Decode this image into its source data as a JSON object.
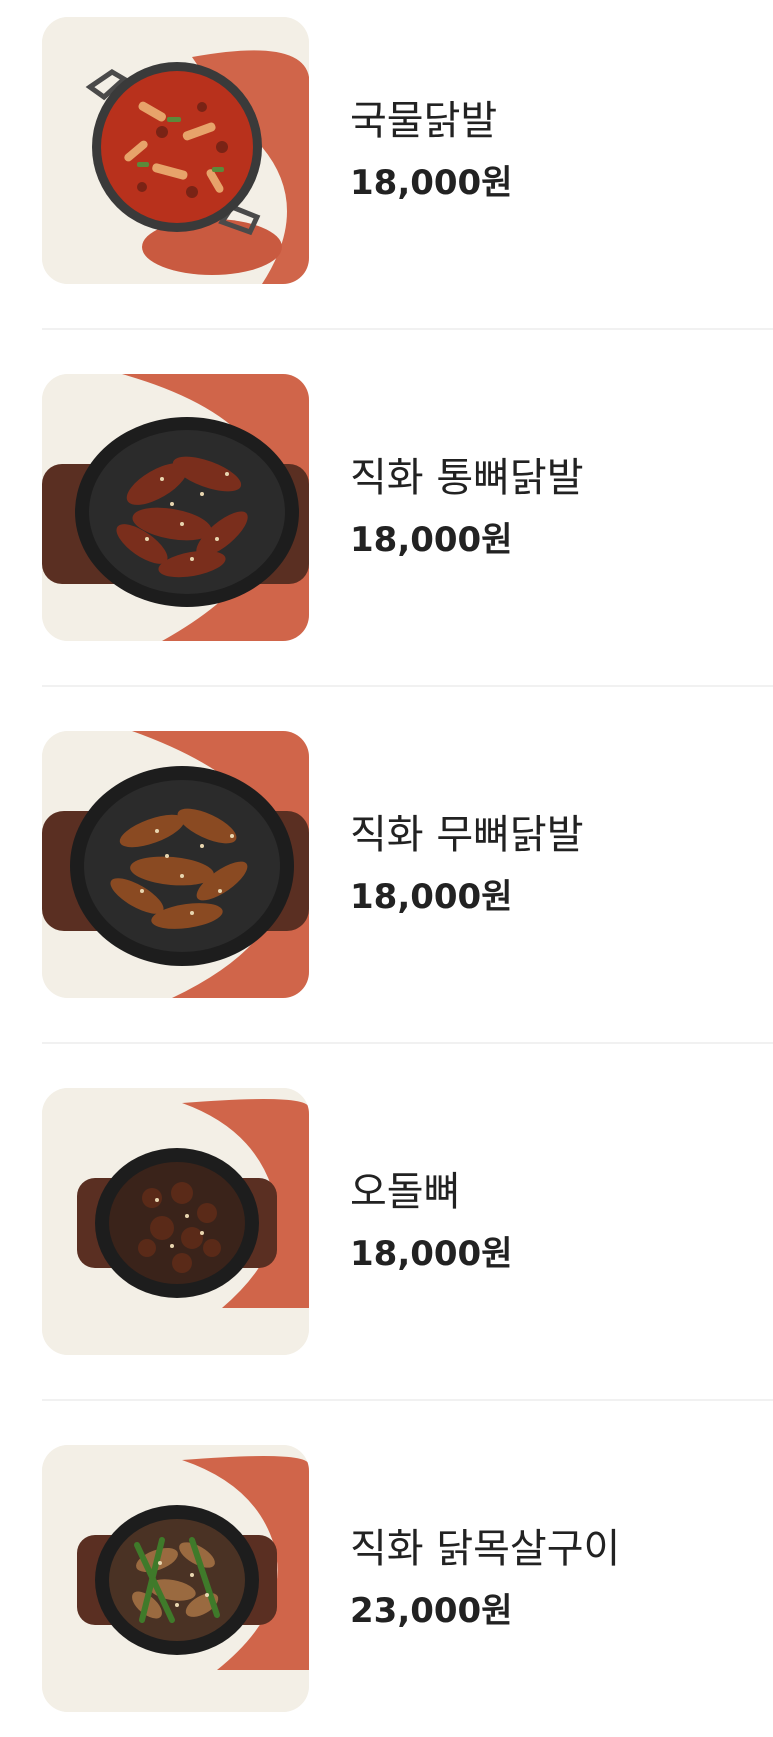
{
  "menu": {
    "items": [
      {
        "name": "국물닭발",
        "price": "18,000원",
        "image": "spicy-chicken-feet-soup-photo"
      },
      {
        "name": "직화 통뼈닭발",
        "price": "18,000원",
        "image": "grilled-bone-in-chicken-feet-photo"
      },
      {
        "name": "직화 무뼈닭발",
        "price": "18,000원",
        "image": "grilled-boneless-chicken-feet-photo"
      },
      {
        "name": "오돌뼈",
        "price": "18,000원",
        "image": "grilled-pork-cartilage-photo"
      },
      {
        "name": "직화 닭목살구이",
        "price": "23,000원",
        "image": "grilled-chicken-neck-photo"
      }
    ]
  },
  "colors": {
    "background": "#ffffff",
    "thumb_cream": "#f3efe6",
    "thumb_terracotta": "#d0654a",
    "text": "#222222",
    "divider": "#f1f1f1"
  }
}
